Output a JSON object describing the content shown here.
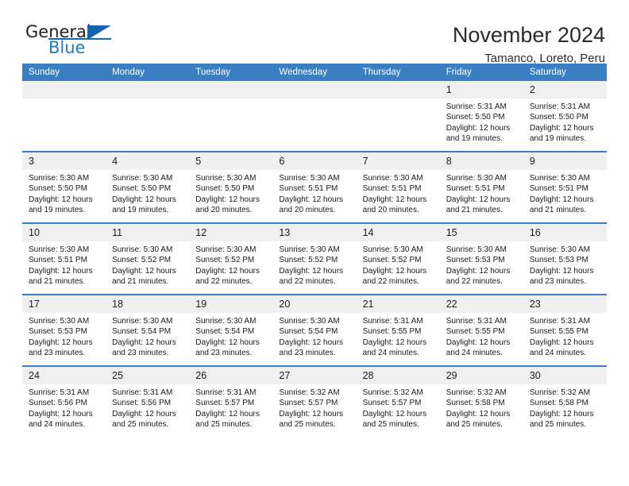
{
  "brand": {
    "name_part1": "General",
    "name_part2": "Blue",
    "accent_color": "#1366b0"
  },
  "header": {
    "month_title": "November 2024",
    "location": "Tamanco, Loreto, Peru"
  },
  "calendar": {
    "header_color": "#3a7fc1",
    "daynum_band_color": "#efefef",
    "weekday_headers": [
      "Sunday",
      "Monday",
      "Tuesday",
      "Wednesday",
      "Thursday",
      "Friday",
      "Saturday"
    ],
    "weeks": [
      [
        {
          "day": "",
          "lines": []
        },
        {
          "day": "",
          "lines": []
        },
        {
          "day": "",
          "lines": []
        },
        {
          "day": "",
          "lines": []
        },
        {
          "day": "",
          "lines": []
        },
        {
          "day": "1",
          "lines": [
            "Sunrise: 5:31 AM",
            "Sunset: 5:50 PM",
            "Daylight: 12 hours",
            "and 19 minutes."
          ]
        },
        {
          "day": "2",
          "lines": [
            "Sunrise: 5:31 AM",
            "Sunset: 5:50 PM",
            "Daylight: 12 hours",
            "and 19 minutes."
          ]
        }
      ],
      [
        {
          "day": "3",
          "lines": [
            "Sunrise: 5:30 AM",
            "Sunset: 5:50 PM",
            "Daylight: 12 hours",
            "and 19 minutes."
          ]
        },
        {
          "day": "4",
          "lines": [
            "Sunrise: 5:30 AM",
            "Sunset: 5:50 PM",
            "Daylight: 12 hours",
            "and 19 minutes."
          ]
        },
        {
          "day": "5",
          "lines": [
            "Sunrise: 5:30 AM",
            "Sunset: 5:50 PM",
            "Daylight: 12 hours",
            "and 20 minutes."
          ]
        },
        {
          "day": "6",
          "lines": [
            "Sunrise: 5:30 AM",
            "Sunset: 5:51 PM",
            "Daylight: 12 hours",
            "and 20 minutes."
          ]
        },
        {
          "day": "7",
          "lines": [
            "Sunrise: 5:30 AM",
            "Sunset: 5:51 PM",
            "Daylight: 12 hours",
            "and 20 minutes."
          ]
        },
        {
          "day": "8",
          "lines": [
            "Sunrise: 5:30 AM",
            "Sunset: 5:51 PM",
            "Daylight: 12 hours",
            "and 21 minutes."
          ]
        },
        {
          "day": "9",
          "lines": [
            "Sunrise: 5:30 AM",
            "Sunset: 5:51 PM",
            "Daylight: 12 hours",
            "and 21 minutes."
          ]
        }
      ],
      [
        {
          "day": "10",
          "lines": [
            "Sunrise: 5:30 AM",
            "Sunset: 5:51 PM",
            "Daylight: 12 hours",
            "and 21 minutes."
          ]
        },
        {
          "day": "11",
          "lines": [
            "Sunrise: 5:30 AM",
            "Sunset: 5:52 PM",
            "Daylight: 12 hours",
            "and 21 minutes."
          ]
        },
        {
          "day": "12",
          "lines": [
            "Sunrise: 5:30 AM",
            "Sunset: 5:52 PM",
            "Daylight: 12 hours",
            "and 22 minutes."
          ]
        },
        {
          "day": "13",
          "lines": [
            "Sunrise: 5:30 AM",
            "Sunset: 5:52 PM",
            "Daylight: 12 hours",
            "and 22 minutes."
          ]
        },
        {
          "day": "14",
          "lines": [
            "Sunrise: 5:30 AM",
            "Sunset: 5:52 PM",
            "Daylight: 12 hours",
            "and 22 minutes."
          ]
        },
        {
          "day": "15",
          "lines": [
            "Sunrise: 5:30 AM",
            "Sunset: 5:53 PM",
            "Daylight: 12 hours",
            "and 22 minutes."
          ]
        },
        {
          "day": "16",
          "lines": [
            "Sunrise: 5:30 AM",
            "Sunset: 5:53 PM",
            "Daylight: 12 hours",
            "and 23 minutes."
          ]
        }
      ],
      [
        {
          "day": "17",
          "lines": [
            "Sunrise: 5:30 AM",
            "Sunset: 5:53 PM",
            "Daylight: 12 hours",
            "and 23 minutes."
          ]
        },
        {
          "day": "18",
          "lines": [
            "Sunrise: 5:30 AM",
            "Sunset: 5:54 PM",
            "Daylight: 12 hours",
            "and 23 minutes."
          ]
        },
        {
          "day": "19",
          "lines": [
            "Sunrise: 5:30 AM",
            "Sunset: 5:54 PM",
            "Daylight: 12 hours",
            "and 23 minutes."
          ]
        },
        {
          "day": "20",
          "lines": [
            "Sunrise: 5:30 AM",
            "Sunset: 5:54 PM",
            "Daylight: 12 hours",
            "and 23 minutes."
          ]
        },
        {
          "day": "21",
          "lines": [
            "Sunrise: 5:31 AM",
            "Sunset: 5:55 PM",
            "Daylight: 12 hours",
            "and 24 minutes."
          ]
        },
        {
          "day": "22",
          "lines": [
            "Sunrise: 5:31 AM",
            "Sunset: 5:55 PM",
            "Daylight: 12 hours",
            "and 24 minutes."
          ]
        },
        {
          "day": "23",
          "lines": [
            "Sunrise: 5:31 AM",
            "Sunset: 5:55 PM",
            "Daylight: 12 hours",
            "and 24 minutes."
          ]
        }
      ],
      [
        {
          "day": "24",
          "lines": [
            "Sunrise: 5:31 AM",
            "Sunset: 5:56 PM",
            "Daylight: 12 hours",
            "and 24 minutes."
          ]
        },
        {
          "day": "25",
          "lines": [
            "Sunrise: 5:31 AM",
            "Sunset: 5:56 PM",
            "Daylight: 12 hours",
            "and 25 minutes."
          ]
        },
        {
          "day": "26",
          "lines": [
            "Sunrise: 5:31 AM",
            "Sunset: 5:57 PM",
            "Daylight: 12 hours",
            "and 25 minutes."
          ]
        },
        {
          "day": "27",
          "lines": [
            "Sunrise: 5:32 AM",
            "Sunset: 5:57 PM",
            "Daylight: 12 hours",
            "and 25 minutes."
          ]
        },
        {
          "day": "28",
          "lines": [
            "Sunrise: 5:32 AM",
            "Sunset: 5:57 PM",
            "Daylight: 12 hours",
            "and 25 minutes."
          ]
        },
        {
          "day": "29",
          "lines": [
            "Sunrise: 5:32 AM",
            "Sunset: 5:58 PM",
            "Daylight: 12 hours",
            "and 25 minutes."
          ]
        },
        {
          "day": "30",
          "lines": [
            "Sunrise: 5:32 AM",
            "Sunset: 5:58 PM",
            "Daylight: 12 hours",
            "and 25 minutes."
          ]
        }
      ]
    ]
  }
}
